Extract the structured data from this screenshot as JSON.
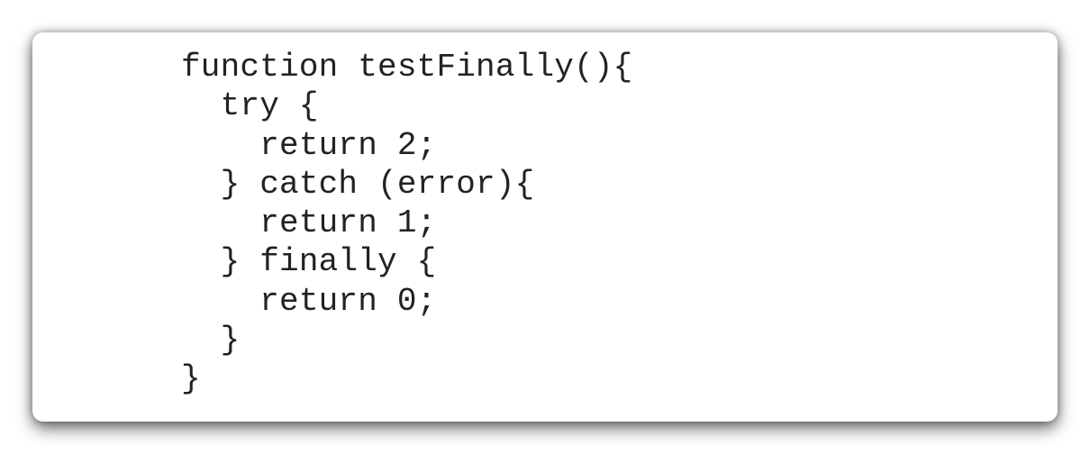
{
  "code": {
    "lines": [
      "function testFinally(){",
      "  try {",
      "    return 2;",
      "  } catch (error){",
      "    return 1;",
      "  } finally {",
      "    return 0;",
      "  }",
      "}"
    ]
  }
}
